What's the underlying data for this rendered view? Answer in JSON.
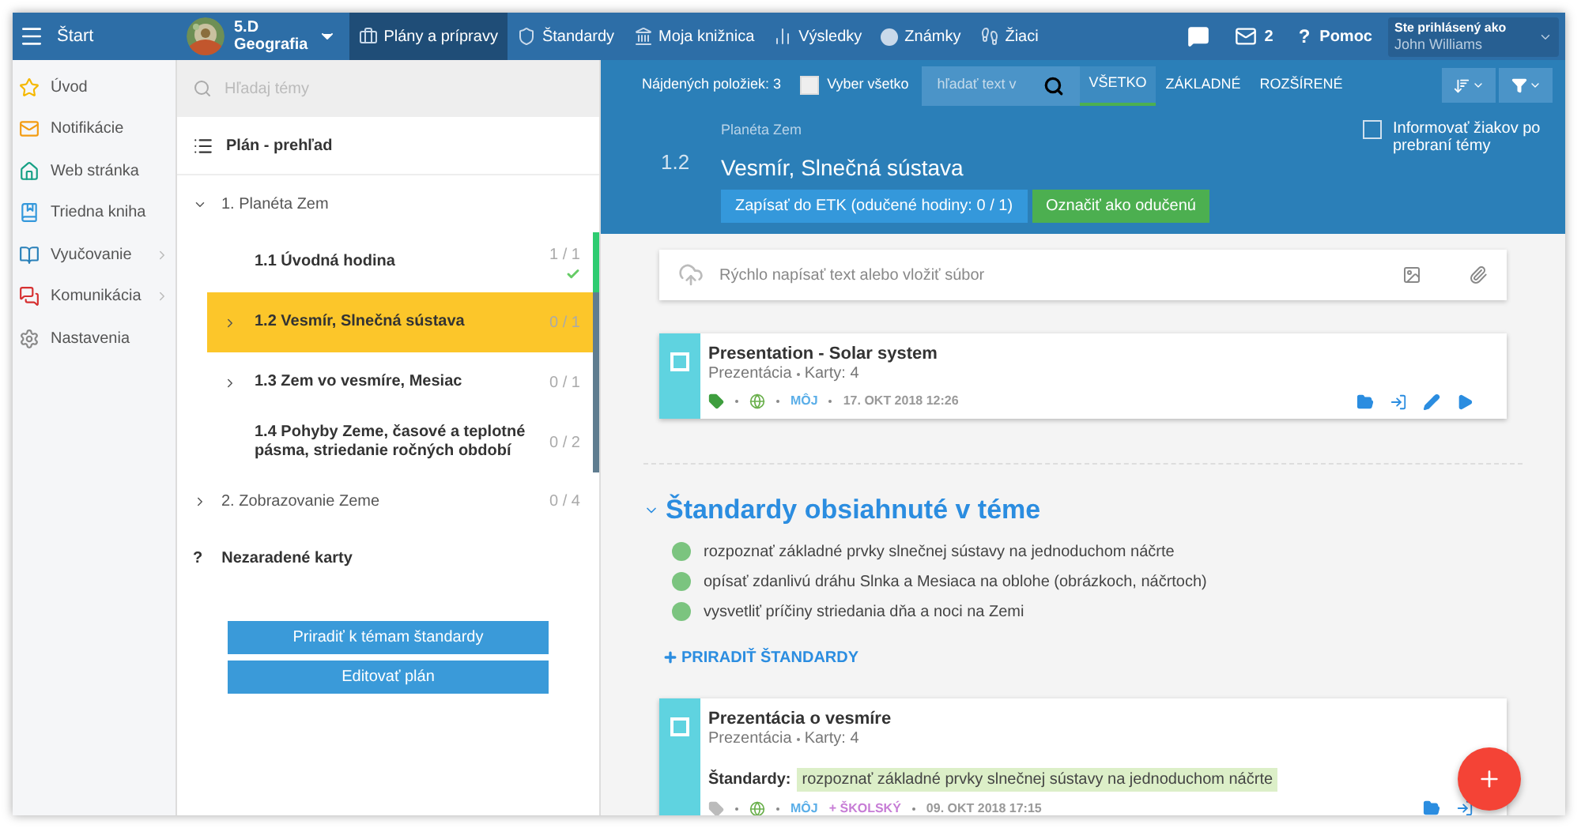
{
  "top_bar": {
    "menu_label": "Štart",
    "class": {
      "name": "5.D",
      "subject": "Geografia"
    },
    "nav": [
      {
        "label": "Plány a prípravy",
        "selected": true
      },
      {
        "label": "Štandardy",
        "selected": false
      },
      {
        "label": "Moja knižnica",
        "selected": false
      },
      {
        "label": "Výsledky",
        "selected": false
      },
      {
        "label": "Známky",
        "selected": false
      },
      {
        "label": "Žiaci",
        "selected": false
      }
    ],
    "messages_count": "2",
    "help_mark": "?",
    "help_label": "Pomoc",
    "user": {
      "caption": "Ste prihlásený ako",
      "name": "John Williams"
    }
  },
  "sidebar": {
    "items": [
      {
        "label": "Úvod",
        "has_submenu": false
      },
      {
        "label": "Notifikácie",
        "has_submenu": false
      },
      {
        "label": "Web stránka",
        "has_submenu": false
      },
      {
        "label": "Triedna kniha",
        "has_submenu": false
      },
      {
        "label": "Vyučovanie",
        "has_submenu": true
      },
      {
        "label": "Komunikácia",
        "has_submenu": true
      },
      {
        "label": "Nastavenia",
        "has_submenu": false
      }
    ]
  },
  "plan": {
    "search_placeholder": "Hľadaj témy",
    "overview": "Plán - prehľad",
    "topics": [
      {
        "label": "1. Planéta Zem",
        "expanded": true,
        "children": [
          {
            "number": "1.1",
            "label": "Úvodná hodina",
            "count": "1 / 1",
            "done": true,
            "selected": false,
            "expandable": false
          },
          {
            "number": "1.2",
            "label": "Vesmír, Slnečná sústava",
            "count": "0 / 1",
            "done": false,
            "selected": true,
            "expandable": true
          },
          {
            "number": "1.3",
            "label": "Zem vo vesmíre, Mesiac",
            "count": "0 / 1",
            "done": false,
            "selected": false,
            "expandable": true
          },
          {
            "number": "1.4",
            "label": "Pohyby Zeme, časové a teplotné pásma, striedanie ročných období",
            "count": "0 / 2",
            "done": false,
            "selected": false,
            "expandable": false
          }
        ]
      },
      {
        "label": "2. Zobrazovanie Zeme",
        "expanded": false,
        "count": "0 / 4"
      }
    ],
    "unassigned": {
      "mark": "?",
      "label": "Nezaradené karty"
    },
    "buttons": [
      "Priradiť k témam štandardy",
      "Editovať plán"
    ]
  },
  "toolbar": {
    "found": "Nájdených položiek: 3",
    "select_all": {
      "label": "Vyber všetko",
      "checked": false
    },
    "search_placeholder": "hľadať text v",
    "filters": [
      {
        "label": "VŠETKO",
        "selected": true
      },
      {
        "label": "ZÁKLADNÉ",
        "selected": false
      },
      {
        "label": "ROZŠÍRENÉ",
        "selected": false
      }
    ]
  },
  "topic": {
    "parent": "Planéta Zem",
    "number": "1.2",
    "title": "Vesmír, Slnečná sústava",
    "buttons": [
      {
        "label": "Zapísať do ETK (odučené hodiny: 0 / 1)",
        "kind": "primary"
      },
      {
        "label": "Označiť ako odučenú",
        "kind": "success"
      }
    ],
    "notify": {
      "label": "Informovať žiakov po prebraní témy",
      "checked": false
    }
  },
  "quick_input": {
    "placeholder": "Rýchlo napísať text alebo vložiť súbor"
  },
  "content": [
    {
      "kind": "card",
      "title": "Presentation - Solar system",
      "type": "Prezentácia",
      "cards": "Karty: 4",
      "checked": false,
      "tagged": true,
      "owners": [
        {
          "label": "MÔJ",
          "color": "#5aaee8"
        }
      ],
      "date": "17. OKT 2018 12:26"
    },
    {
      "kind": "standards",
      "title": "Štandardy obsiahnuté v téme",
      "items": [
        "rozpoznať základné prvky slnečnej sústavy na jednoduchom náčrte",
        "opísať zdanlivú dráhu Slnka a Mesiaca na oblohe (obrázkoch, náčrtoch)",
        "vysvetliť príčiny striedania dňa a noci na Zemi"
      ],
      "add_label": "PRIRADIŤ ŠTANDARDY"
    },
    {
      "kind": "card",
      "title": "Prezentácia o vesmíre",
      "type": "Prezentácia",
      "cards": "Karty: 4",
      "checked": false,
      "tagged": false,
      "standards_label": "Štandardy:",
      "standard": "rozpoznať základné prvky slnečnej sústavy na jednoduchom náčrte",
      "owners": [
        {
          "label": "MÔJ",
          "color": "#5aaee8"
        },
        {
          "label": "+ ŠKOLSKÝ",
          "color": "#c77dd6"
        }
      ],
      "date": "09. OKT 2018 17:15"
    }
  ]
}
